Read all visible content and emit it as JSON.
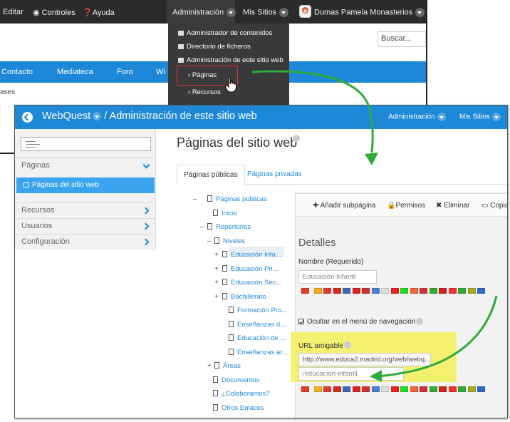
{
  "background_window": {
    "topbar": {
      "edit": "Editar",
      "controls": "Controles",
      "help": "Ayuda",
      "admin": "Administración",
      "my_sites": "Mis Sitios",
      "user": "Dumas Pamela Monasterios"
    },
    "search_value": "Buscar...",
    "nav": [
      "Contacto",
      "Mediateca",
      "Foro",
      "Wi"
    ],
    "breadcrumb": "ases",
    "dropdown": {
      "items": [
        "Administrador de contenidos",
        "Directorio de ficheros",
        "Administración de este sitio web"
      ],
      "sub_items": [
        "Páginas",
        "Recursos"
      ]
    }
  },
  "window": {
    "site_name": "WebQuest",
    "title_suffix": "/ Administración de este sitio web",
    "header_admin": "Administración",
    "header_my_sites": "Mis Sitios"
  },
  "sidebar": {
    "section_pages": "Páginas",
    "active_item": "Páginas del sitio web",
    "sections": [
      "Recursos",
      "Usuarios",
      "Configuración"
    ]
  },
  "main": {
    "title": "Páginas del sitio web",
    "tabs": [
      "Páginas públicas",
      "Páginas privadas"
    ]
  },
  "tree": {
    "items": [
      {
        "toggle": "–",
        "label": "Páginas públicas"
      },
      {
        "toggle": "",
        "label": "Inicio"
      },
      {
        "toggle": "–",
        "label": "Repertorios"
      },
      {
        "toggle": "–",
        "label": "Niveles"
      },
      {
        "toggle": "+",
        "label": "Educación Infa..."
      },
      {
        "toggle": "+",
        "label": "Educación Pri..."
      },
      {
        "toggle": "+",
        "label": "Educación Sec..."
      },
      {
        "toggle": "+",
        "label": "Bachillerato"
      },
      {
        "toggle": "",
        "label": "Formación Pro..."
      },
      {
        "toggle": "",
        "label": "Enseñanzas d..."
      },
      {
        "toggle": "",
        "label": "Educación de ..."
      },
      {
        "toggle": "",
        "label": "Enseñanzas ar..."
      },
      {
        "toggle": "+",
        "label": "Áreas"
      },
      {
        "toggle": "",
        "label": "Documentos"
      },
      {
        "toggle": "",
        "label": "¿Colaboramos?"
      },
      {
        "toggle": "",
        "label": "Otros Enlaces"
      }
    ]
  },
  "toolbar": {
    "add": "Añadir subpágina",
    "permissions": "Permisos",
    "delete": "Eliminar",
    "copy": "Copia"
  },
  "details": {
    "title": "Detalles",
    "name_label": "Nombre (Requerido)",
    "name_value": "Educación Infantil",
    "hide_label": "Ocultar en el menú de navegación",
    "url_label": "URL amigable",
    "url_prefix": "http://www.educa2.madrid.org/web/webq...",
    "url_value": "/educacion-infantil"
  },
  "colors": {
    "primary_blue": "#1e88d8",
    "dark_bar": "#2b2b2b",
    "highlight_yellow": "#f4f15a",
    "arrow_green": "#2eaa3a",
    "highlight_red": "#e0322b"
  },
  "flag_colors": [
    "#e8392b",
    "#f2b01e",
    "#e03b2f",
    "#d52b1e",
    "#3b6bb5",
    "#d22",
    "#c33",
    "#4a7fd0",
    "#ddd",
    "#e22",
    "#2d2",
    "#e63",
    "#c33",
    "#3a3",
    "#c22",
    "#e33",
    "#3a3",
    "#aa2",
    "#36c"
  ]
}
